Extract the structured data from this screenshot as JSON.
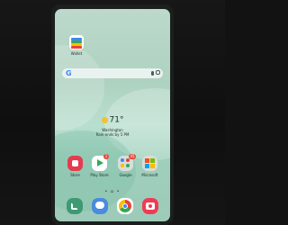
{
  "photo": {
    "subject": "Smartphone home screen",
    "colors": {
      "frame": "#1b1f1e",
      "wallpaper": "#aed2c0",
      "accent": "#4285f4"
    }
  },
  "home": {
    "top_app": {
      "label": "Wallet",
      "icon": "wallet-icon"
    },
    "search_bar": {
      "logo": "G",
      "icons": [
        "google-logo-icon",
        "microphone-icon",
        "lens-icon"
      ]
    },
    "weather": {
      "temperature": "71°",
      "location": "Washington",
      "subtitle": "Rain ends by 5 PM",
      "icon": "sun-icon"
    },
    "apps": [
      {
        "label": "Store",
        "icon": "store-icon",
        "color": "#e53b4f"
      },
      {
        "label": "Play Store",
        "icon": "play-store-icon",
        "color": "#ffffff",
        "badge": "1"
      },
      {
        "label": "Google",
        "icon": "google-folder-icon",
        "color": "#d9ddd9",
        "badge": "45"
      },
      {
        "label": "Microsoft",
        "icon": "microsoft-folder-icon",
        "color": "#d9ddd9"
      }
    ],
    "page_indicator": "• ⌂ •",
    "dock": [
      {
        "name": "phone",
        "icon": "phone-icon",
        "color": "#3d9a72"
      },
      {
        "name": "messages",
        "icon": "messages-icon",
        "color": "#4a8ae0"
      },
      {
        "name": "chrome",
        "icon": "chrome-icon",
        "color": "#ffffff"
      },
      {
        "name": "camera",
        "icon": "camera-icon",
        "color": "#ef3b55"
      }
    ]
  }
}
